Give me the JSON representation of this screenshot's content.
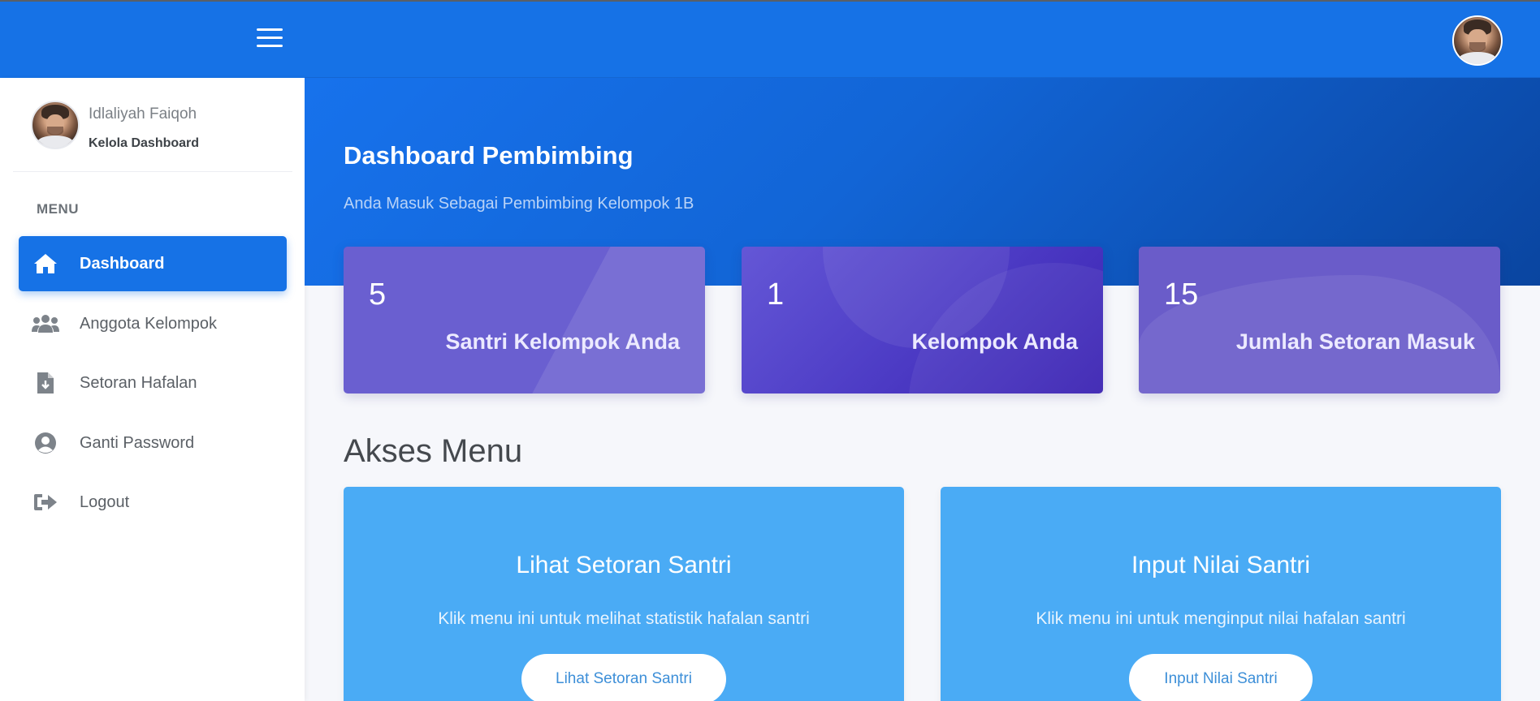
{
  "user": {
    "name": "Idlaliyah Faiqoh",
    "role": "Kelola Dashboard"
  },
  "sidebar": {
    "heading": "MENU",
    "items": [
      {
        "label": "Dashboard",
        "icon": "home-icon",
        "active": true
      },
      {
        "label": "Anggota Kelompok",
        "icon": "users-icon",
        "active": false
      },
      {
        "label": "Setoran Hafalan",
        "icon": "file-download-icon",
        "active": false
      },
      {
        "label": "Ganti Password",
        "icon": "user-circle-icon",
        "active": false
      },
      {
        "label": "Logout",
        "icon": "sign-out-icon",
        "active": false
      }
    ]
  },
  "hero": {
    "title": "Dashboard Pembimbing",
    "subtitle": "Anda Masuk Sebagai Pembimbing Kelompok 1B"
  },
  "stats": [
    {
      "value": "5",
      "label": "Santri Kelompok Anda"
    },
    {
      "value": "1",
      "label": "Kelompok Anda"
    },
    {
      "value": "15",
      "label": "Jumlah Setoran Masuk"
    }
  ],
  "access_menu": {
    "title": "Akses Menu",
    "cards": [
      {
        "title": "Lihat Setoran Santri",
        "description": "Klik menu ini untuk melihat statistik hafalan santri",
        "button": "Lihat Setoran Santri"
      },
      {
        "title": "Input Nilai Santri",
        "description": "Klik menu ini untuk menginput nilai hafalan santri",
        "button": "Input Nilai Santri"
      }
    ]
  },
  "colors": {
    "primary": "#1672e6",
    "stat_card": "#6a5fd0",
    "access_card": "#4aabf5"
  }
}
